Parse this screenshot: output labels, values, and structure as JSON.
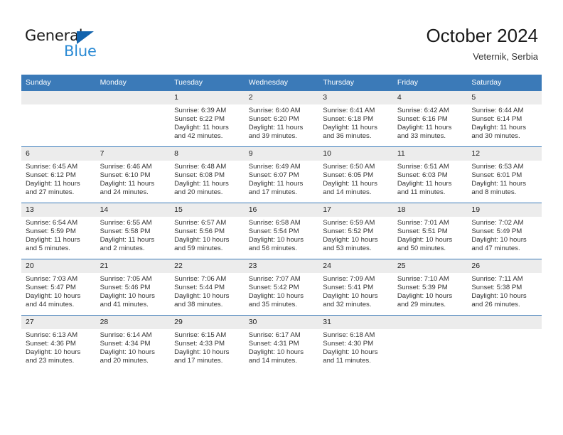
{
  "brand": {
    "name_top": "General",
    "name_bottom": "Blue"
  },
  "header": {
    "title": "October 2024",
    "subtitle": "Veternik, Serbia"
  },
  "colors": {
    "header_blue": "#3b7ab8",
    "logo_blue": "#2a8ad4",
    "logo_triangle": "#1263ad",
    "daynum_band": "#ececec"
  },
  "weekday_headers": [
    "Sunday",
    "Monday",
    "Tuesday",
    "Wednesday",
    "Thursday",
    "Friday",
    "Saturday"
  ],
  "labels": {
    "sunrise_prefix": "Sunrise:",
    "sunset_prefix": "Sunset:",
    "daylight_prefix": "Daylight:"
  },
  "weeks": [
    [
      {
        "day": "",
        "empty": true
      },
      {
        "day": "",
        "empty": true
      },
      {
        "day": "1",
        "sunrise": "Sunrise: 6:39 AM",
        "sunset": "Sunset: 6:22 PM",
        "daylight": "Daylight: 11 hours and 42 minutes."
      },
      {
        "day": "2",
        "sunrise": "Sunrise: 6:40 AM",
        "sunset": "Sunset: 6:20 PM",
        "daylight": "Daylight: 11 hours and 39 minutes."
      },
      {
        "day": "3",
        "sunrise": "Sunrise: 6:41 AM",
        "sunset": "Sunset: 6:18 PM",
        "daylight": "Daylight: 11 hours and 36 minutes."
      },
      {
        "day": "4",
        "sunrise": "Sunrise: 6:42 AM",
        "sunset": "Sunset: 6:16 PM",
        "daylight": "Daylight: 11 hours and 33 minutes."
      },
      {
        "day": "5",
        "sunrise": "Sunrise: 6:44 AM",
        "sunset": "Sunset: 6:14 PM",
        "daylight": "Daylight: 11 hours and 30 minutes."
      }
    ],
    [
      {
        "day": "6",
        "sunrise": "Sunrise: 6:45 AM",
        "sunset": "Sunset: 6:12 PM",
        "daylight": "Daylight: 11 hours and 27 minutes."
      },
      {
        "day": "7",
        "sunrise": "Sunrise: 6:46 AM",
        "sunset": "Sunset: 6:10 PM",
        "daylight": "Daylight: 11 hours and 24 minutes."
      },
      {
        "day": "8",
        "sunrise": "Sunrise: 6:48 AM",
        "sunset": "Sunset: 6:08 PM",
        "daylight": "Daylight: 11 hours and 20 minutes."
      },
      {
        "day": "9",
        "sunrise": "Sunrise: 6:49 AM",
        "sunset": "Sunset: 6:07 PM",
        "daylight": "Daylight: 11 hours and 17 minutes."
      },
      {
        "day": "10",
        "sunrise": "Sunrise: 6:50 AM",
        "sunset": "Sunset: 6:05 PM",
        "daylight": "Daylight: 11 hours and 14 minutes."
      },
      {
        "day": "11",
        "sunrise": "Sunrise: 6:51 AM",
        "sunset": "Sunset: 6:03 PM",
        "daylight": "Daylight: 11 hours and 11 minutes."
      },
      {
        "day": "12",
        "sunrise": "Sunrise: 6:53 AM",
        "sunset": "Sunset: 6:01 PM",
        "daylight": "Daylight: 11 hours and 8 minutes."
      }
    ],
    [
      {
        "day": "13",
        "sunrise": "Sunrise: 6:54 AM",
        "sunset": "Sunset: 5:59 PM",
        "daylight": "Daylight: 11 hours and 5 minutes."
      },
      {
        "day": "14",
        "sunrise": "Sunrise: 6:55 AM",
        "sunset": "Sunset: 5:58 PM",
        "daylight": "Daylight: 11 hours and 2 minutes."
      },
      {
        "day": "15",
        "sunrise": "Sunrise: 6:57 AM",
        "sunset": "Sunset: 5:56 PM",
        "daylight": "Daylight: 10 hours and 59 minutes."
      },
      {
        "day": "16",
        "sunrise": "Sunrise: 6:58 AM",
        "sunset": "Sunset: 5:54 PM",
        "daylight": "Daylight: 10 hours and 56 minutes."
      },
      {
        "day": "17",
        "sunrise": "Sunrise: 6:59 AM",
        "sunset": "Sunset: 5:52 PM",
        "daylight": "Daylight: 10 hours and 53 minutes."
      },
      {
        "day": "18",
        "sunrise": "Sunrise: 7:01 AM",
        "sunset": "Sunset: 5:51 PM",
        "daylight": "Daylight: 10 hours and 50 minutes."
      },
      {
        "day": "19",
        "sunrise": "Sunrise: 7:02 AM",
        "sunset": "Sunset: 5:49 PM",
        "daylight": "Daylight: 10 hours and 47 minutes."
      }
    ],
    [
      {
        "day": "20",
        "sunrise": "Sunrise: 7:03 AM",
        "sunset": "Sunset: 5:47 PM",
        "daylight": "Daylight: 10 hours and 44 minutes."
      },
      {
        "day": "21",
        "sunrise": "Sunrise: 7:05 AM",
        "sunset": "Sunset: 5:46 PM",
        "daylight": "Daylight: 10 hours and 41 minutes."
      },
      {
        "day": "22",
        "sunrise": "Sunrise: 7:06 AM",
        "sunset": "Sunset: 5:44 PM",
        "daylight": "Daylight: 10 hours and 38 minutes."
      },
      {
        "day": "23",
        "sunrise": "Sunrise: 7:07 AM",
        "sunset": "Sunset: 5:42 PM",
        "daylight": "Daylight: 10 hours and 35 minutes."
      },
      {
        "day": "24",
        "sunrise": "Sunrise: 7:09 AM",
        "sunset": "Sunset: 5:41 PM",
        "daylight": "Daylight: 10 hours and 32 minutes."
      },
      {
        "day": "25",
        "sunrise": "Sunrise: 7:10 AM",
        "sunset": "Sunset: 5:39 PM",
        "daylight": "Daylight: 10 hours and 29 minutes."
      },
      {
        "day": "26",
        "sunrise": "Sunrise: 7:11 AM",
        "sunset": "Sunset: 5:38 PM",
        "daylight": "Daylight: 10 hours and 26 minutes."
      }
    ],
    [
      {
        "day": "27",
        "sunrise": "Sunrise: 6:13 AM",
        "sunset": "Sunset: 4:36 PM",
        "daylight": "Daylight: 10 hours and 23 minutes."
      },
      {
        "day": "28",
        "sunrise": "Sunrise: 6:14 AM",
        "sunset": "Sunset: 4:34 PM",
        "daylight": "Daylight: 10 hours and 20 minutes."
      },
      {
        "day": "29",
        "sunrise": "Sunrise: 6:15 AM",
        "sunset": "Sunset: 4:33 PM",
        "daylight": "Daylight: 10 hours and 17 minutes."
      },
      {
        "day": "30",
        "sunrise": "Sunrise: 6:17 AM",
        "sunset": "Sunset: 4:31 PM",
        "daylight": "Daylight: 10 hours and 14 minutes."
      },
      {
        "day": "31",
        "sunrise": "Sunrise: 6:18 AM",
        "sunset": "Sunset: 4:30 PM",
        "daylight": "Daylight: 10 hours and 11 minutes."
      },
      {
        "day": "",
        "empty": true
      },
      {
        "day": "",
        "empty": true
      }
    ]
  ]
}
